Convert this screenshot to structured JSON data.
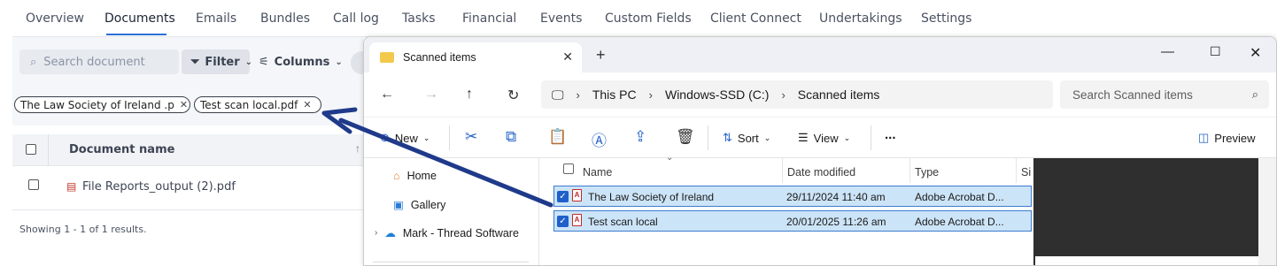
{
  "app": {
    "tabs": [
      "Overview",
      "Documents",
      "Emails",
      "Bundles",
      "Call log",
      "Tasks",
      "Financial",
      "Events",
      "Custom Fields",
      "Client Connect",
      "Undertakings",
      "Settings"
    ],
    "active_tab": "Documents",
    "search_placeholder": "Search document",
    "filter_label": "Filter",
    "columns_label": "Columns",
    "chips": [
      "The Law Society of Ireland .p",
      "Test scan local.pdf"
    ],
    "table": {
      "header": "Document name",
      "rows": [
        "File Reports_output (2).pdf"
      ]
    },
    "showing": "Showing 1 - 1 of 1 results."
  },
  "explorer": {
    "tab_title": "Scanned items",
    "breadcrumb": [
      "This PC",
      "Windows-SSD (C:)",
      "Scanned items"
    ],
    "search_placeholder": "Search Scanned items",
    "commands": {
      "new": "New",
      "sort": "Sort",
      "view": "View",
      "more": "...",
      "preview": "Preview"
    },
    "nav": [
      "Home",
      "Gallery",
      "Mark - Thread Software"
    ],
    "columns": [
      "Name",
      "Date modified",
      "Type",
      "Si"
    ],
    "files": [
      {
        "name": "The Law Society of Ireland",
        "date": "29/11/2024 11:40 am",
        "type": "Adobe Acrobat D..."
      },
      {
        "name": "Test scan local",
        "date": "20/01/2025 11:26 am",
        "type": "Adobe Acrobat D..."
      }
    ]
  },
  "colors": {
    "accent": "#2b6fd6",
    "selection": "#cce4f7",
    "arrow": "#1f3a8a"
  }
}
